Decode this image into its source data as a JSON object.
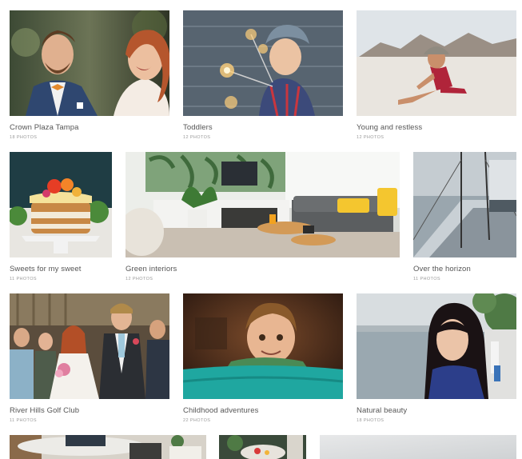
{
  "albums": [
    {
      "title": "Crown Plaza Tampa",
      "count": "18 PHOTOS",
      "image": "wedding-couple-photo"
    },
    {
      "title": "Toddlers",
      "count": "12 PHOTOS",
      "image": "child-with-sparklers-photo"
    },
    {
      "title": "Young and restless",
      "count": "12 PHOTOS",
      "image": "woman-sitting-on-beach-photo"
    },
    {
      "title": "Sweets for my sweet",
      "count": "11 PHOTOS",
      "image": "layered-cake-photo"
    },
    {
      "title": "Green interiors",
      "count": "12 PHOTOS",
      "image": "living-room-interior-photo"
    },
    {
      "title": "Over the horizon",
      "count": "11 PHOTOS",
      "image": "sailboat-deck-photo"
    },
    {
      "title": "River Hills Golf Club",
      "count": "11 PHOTOS",
      "image": "wedding-procession-photo"
    },
    {
      "title": "Childhood adventures",
      "count": "22 PHOTOS",
      "image": "boy-peeking-over-cushion-photo"
    },
    {
      "title": "Natural beauty",
      "count": "18 PHOTOS",
      "image": "woman-by-the-river-photo"
    },
    {
      "title": "",
      "count": "",
      "image": "cafe-table-photo"
    },
    {
      "title": "",
      "count": "",
      "image": "dessert-plates-photo"
    },
    {
      "title": "",
      "count": "",
      "image": "light-gray-photo"
    }
  ]
}
